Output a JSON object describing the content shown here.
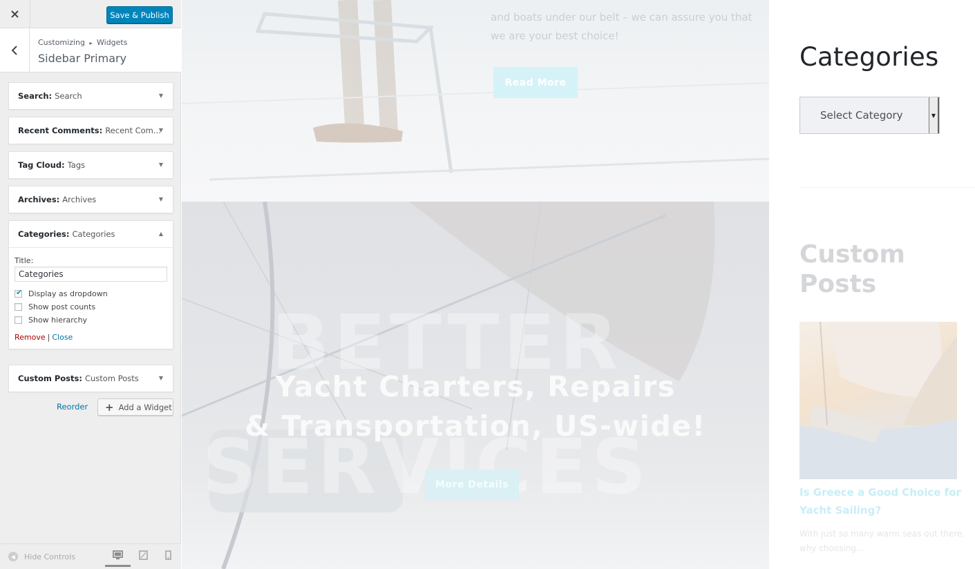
{
  "customizer": {
    "close_icon": "close-icon",
    "publish_label": "Save & Publish",
    "breadcrumb": [
      "Customizing",
      "Widgets"
    ],
    "breadcrumb_sep": "▸",
    "section_title": "Sidebar Primary",
    "widgets": [
      {
        "type": "Search:",
        "title": "Search",
        "expanded": false
      },
      {
        "type": "Recent Comments:",
        "title": "Recent Com...",
        "expanded": false
      },
      {
        "type": "Tag Cloud:",
        "title": "Tags",
        "expanded": false
      },
      {
        "type": "Archives:",
        "title": "Archives",
        "expanded": false
      },
      {
        "type": "Categories:",
        "title": "Categories",
        "expanded": true
      },
      {
        "type": "Custom Posts:",
        "title": "Custom Posts",
        "expanded": false
      }
    ],
    "categories_form": {
      "title_label": "Title:",
      "title_value": "Categories",
      "options": [
        {
          "label": "Display as dropdown",
          "checked": true
        },
        {
          "label": "Show post counts",
          "checked": false
        },
        {
          "label": "Show hierarchy",
          "checked": false
        }
      ],
      "remove_label": "Remove",
      "pipe": "|",
      "close_label": "Close"
    },
    "reorder_label": "Reorder",
    "add_widget_label": "Add a Widget",
    "hide_controls_label": "Hide Controls",
    "devices": [
      "desktop",
      "tablet",
      "mobile"
    ],
    "active_device": "desktop"
  },
  "preview": {
    "top_text_line1": "and boats under our belt – we can assure you that",
    "top_text_line2": "we are your best choice!",
    "read_more": "Read More",
    "bg_word_1": "BETTER",
    "bg_word_2": "SERVICES",
    "hero_title_line1": "Yacht Charters, Repairs",
    "hero_title_line2": "& Transportation, US-wide!",
    "more_details": "More Details",
    "categories_heading": "Categories",
    "select_category": "Select Category",
    "custom_posts_heading": "Custom Posts",
    "post_title": "Is Greece a Good Choice for Yacht Sailing?",
    "post_excerpt": "With just so many warm seas out there, why choosing..."
  },
  "colors": {
    "accent": "#0085ba",
    "link": "#0073aa",
    "remove": "#aa0000",
    "sidebar_bg": "#eeeeee"
  }
}
